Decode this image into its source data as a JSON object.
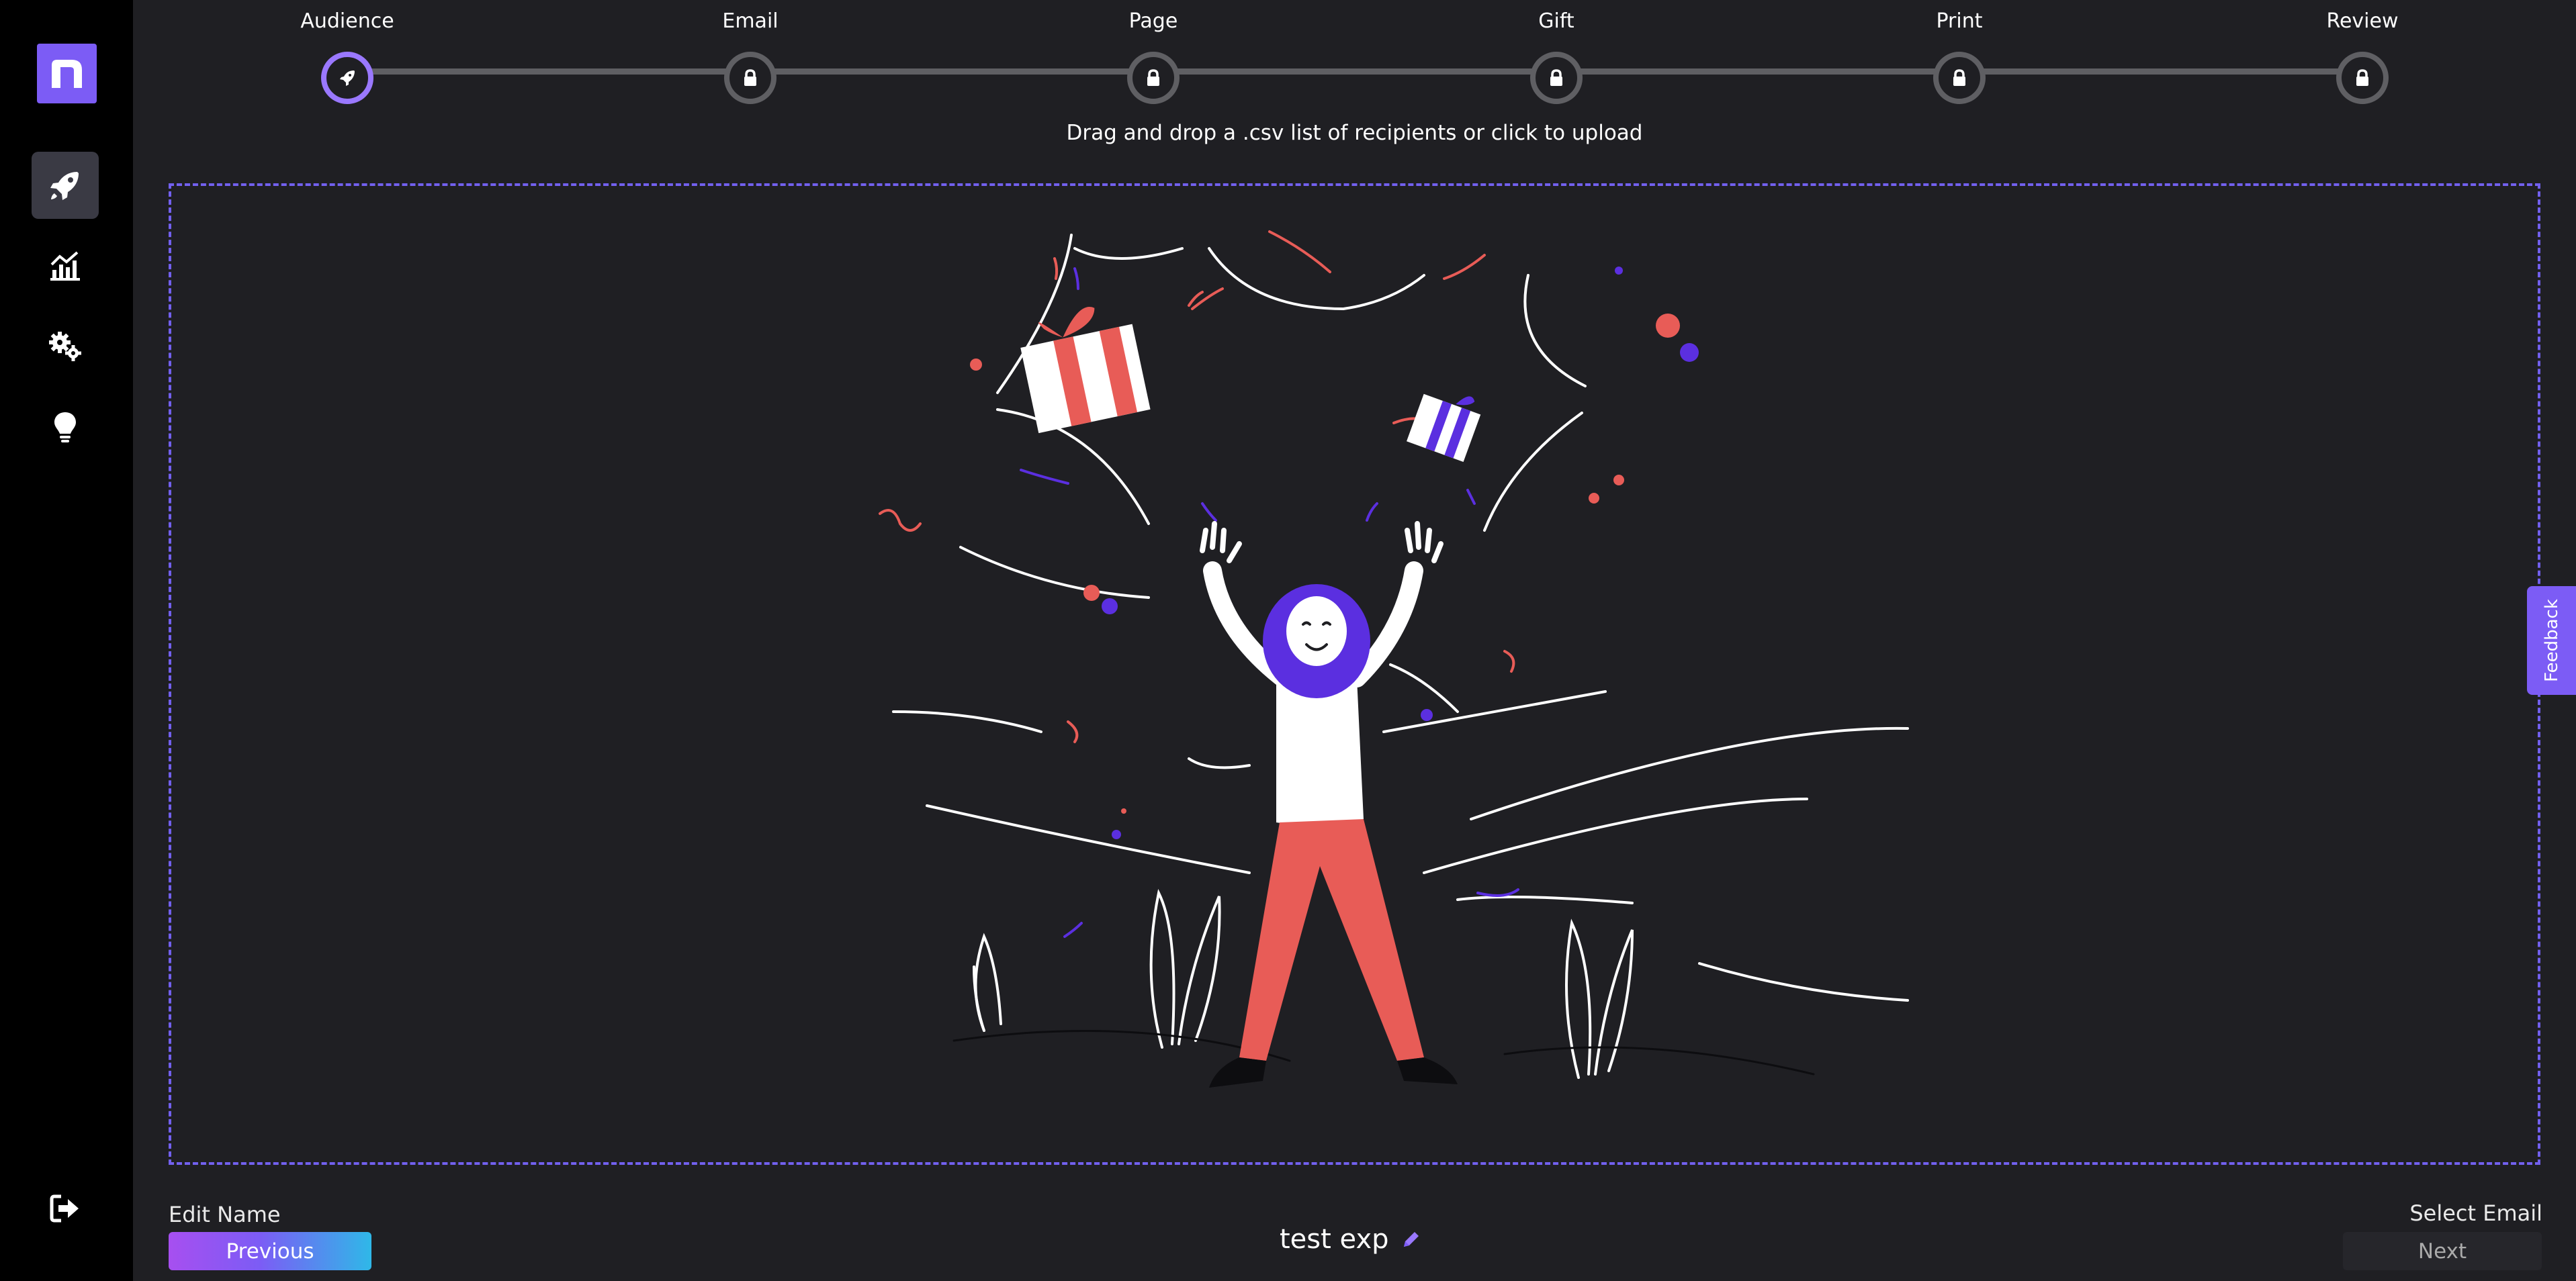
{
  "sidebar": {
    "logo_letter": "n",
    "items": [
      {
        "icon": "rocket-icon",
        "active": true
      },
      {
        "icon": "chart-icon",
        "active": false
      },
      {
        "icon": "gears-icon",
        "active": false
      },
      {
        "icon": "lightbulb-icon",
        "active": false
      }
    ],
    "logout_icon": "logout-icon"
  },
  "stepper": {
    "steps": [
      {
        "label": "Audience",
        "state": "active",
        "icon": "rocket-icon"
      },
      {
        "label": "Email",
        "state": "locked",
        "icon": "lock-icon"
      },
      {
        "label": "Page",
        "state": "locked",
        "icon": "lock-icon"
      },
      {
        "label": "Gift",
        "state": "locked",
        "icon": "lock-icon"
      },
      {
        "label": "Print",
        "state": "locked",
        "icon": "lock-icon"
      },
      {
        "label": "Review",
        "state": "locked",
        "icon": "lock-icon"
      }
    ]
  },
  "upload": {
    "instruction": "Drag and drop a .csv list of recipients or click to upload"
  },
  "feedback_label": "Feedback",
  "footer": {
    "edit_name_label": "Edit Name",
    "previous_label": "Previous",
    "experience_name": "test exp",
    "select_email_label": "Select Email",
    "next_label": "Next"
  },
  "colors": {
    "accent": "#7c5cf5",
    "background": "#1f1f23",
    "sidebar": "#000000",
    "illustration_red": "#e85c57",
    "illustration_purple": "#5b2fe0"
  }
}
